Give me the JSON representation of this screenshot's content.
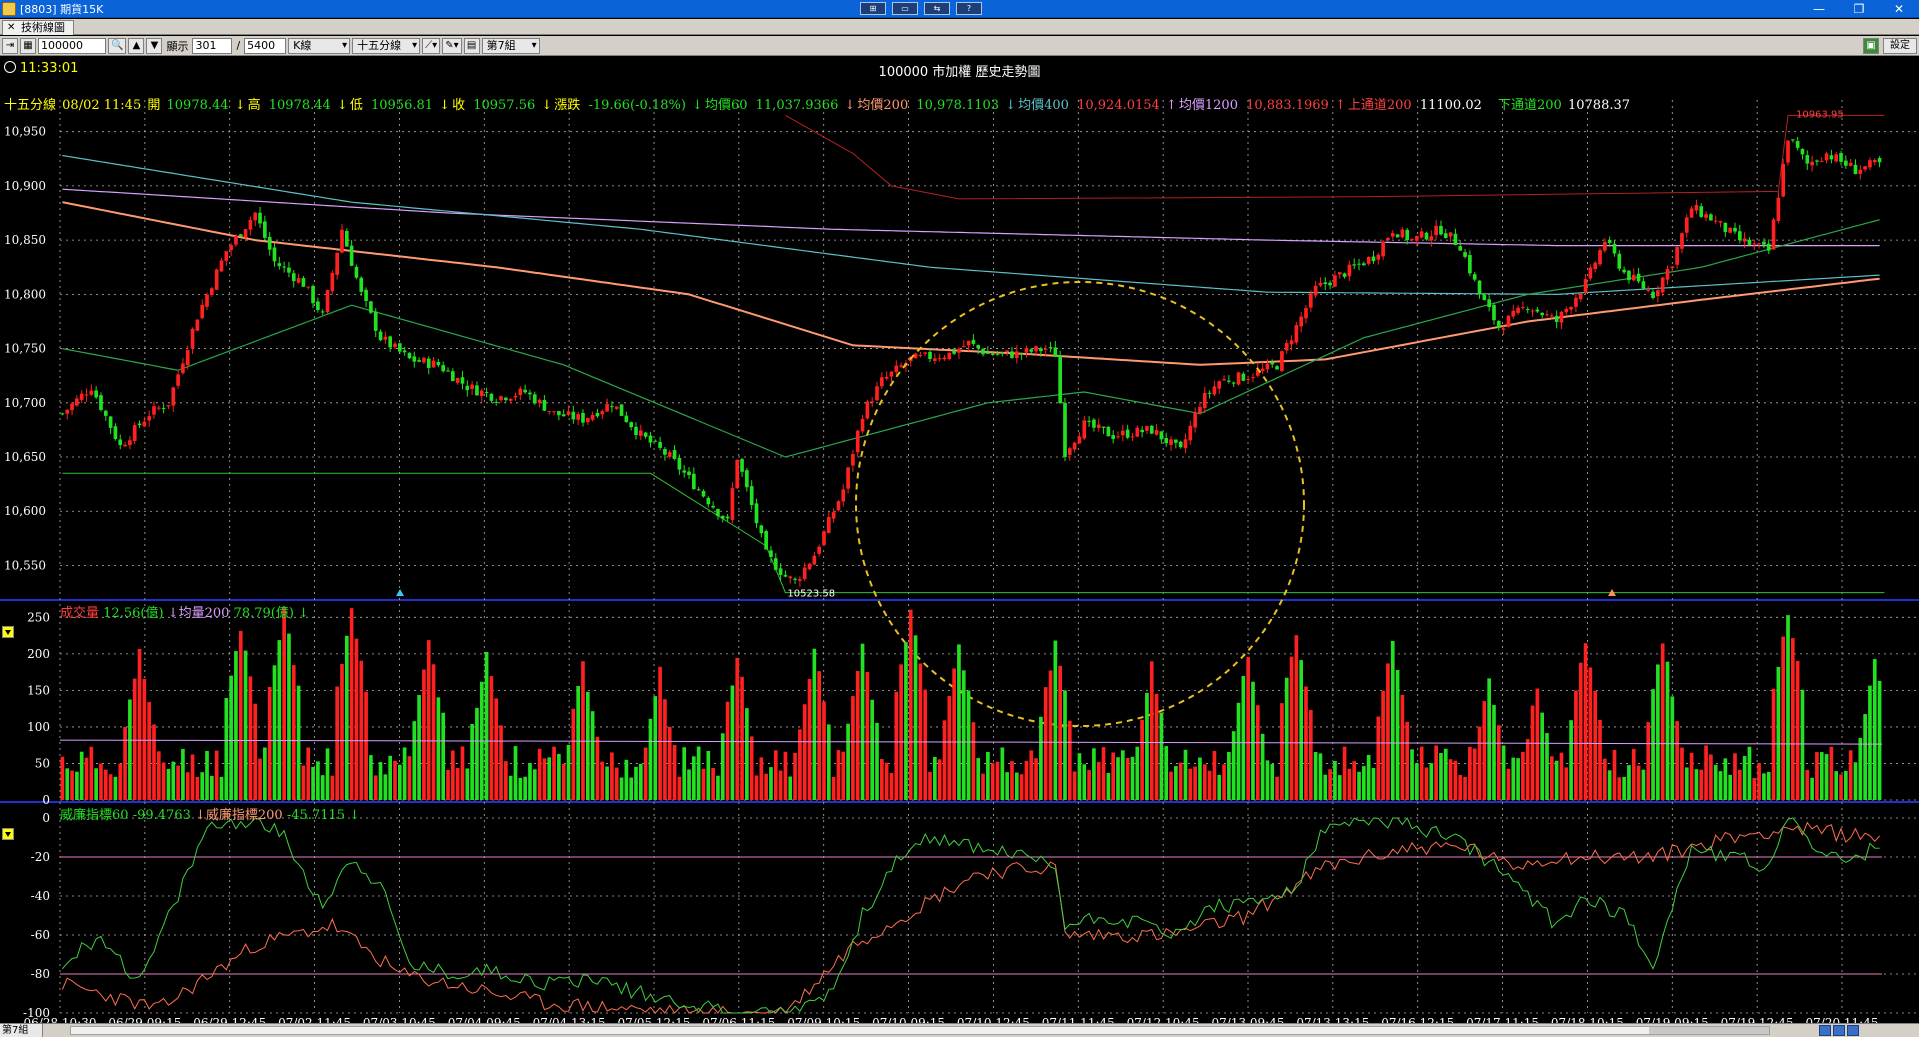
{
  "window": {
    "title": "[8803] 期貨15K",
    "center_buttons": [
      "⊞",
      "▭",
      "⇆",
      "?"
    ],
    "controls": [
      "—",
      "❐",
      "✕"
    ]
  },
  "tab": {
    "label": "技術線圖"
  },
  "toolbar": {
    "symbol": "100000",
    "display_label": "顯示",
    "display_value": "301",
    "slash": "/",
    "total_value": "5400",
    "chart_type": "K線",
    "period": "十五分線",
    "group": "第7組",
    "settings": "設定"
  },
  "header": {
    "clock": "11:33:01",
    "chart_title": "100000 市加權  歷史走勢圖"
  },
  "info_line": {
    "period": "十五分線",
    "datetime": "08/02 11:45",
    "open_label": "開",
    "open": "10978.44",
    "high_label": "高",
    "high": "10978.44",
    "low_label": "低",
    "low": "10956.81",
    "close_label": "收",
    "close": "10957.56",
    "change_label": "漲跌",
    "change": "-19.66(-0.18%)",
    "ma60_label": "均價60",
    "ma60": "11,037.9366",
    "ma200_label": "均價200",
    "ma200": "10,978.1103",
    "ma400_label": "均價400",
    "ma400": "10,924.0154",
    "ma1200_label": "均價1200",
    "ma1200": "10,883.1969",
    "upper_label": "上通道200",
    "upper": "11100.02",
    "lower_label": "下通道200",
    "lower": "10788.37"
  },
  "volume_header": {
    "label": "成交量",
    "value": "12.56(億)",
    "avg_label": "均量200",
    "avg_value": "78.79(億)"
  },
  "williams_header": {
    "label60": "威廉指標60",
    "value60": "-99.4763",
    "label200": "威廉指標200",
    "value200": "-45.7115"
  },
  "bottom": {
    "group": "第7組"
  },
  "colors": {
    "up": "#ff2020",
    "down": "#22e022",
    "grid": "#b0b0b0",
    "ma60": "#2aa84a",
    "ma200": "#ff9a70",
    "ma400": "#5cc0c8",
    "ma1200": "#d9a0ff",
    "upper": "#b82020",
    "lower": "#30c030",
    "circle": "#e8c020",
    "yellow": "#ffff00",
    "white": "#ffffff"
  },
  "chart_data": [
    {
      "type": "candlestick",
      "title": "100000 市加權  歷史走勢圖",
      "ylim": [
        10520,
        10970
      ],
      "y_ticks": [
        10550,
        10600,
        10650,
        10700,
        10750,
        10800,
        10850,
        10900,
        10950
      ],
      "y_tick_labels": [
        "10,550",
        "10,600",
        "10,650",
        "10,700",
        "10,750",
        "10,800",
        "10,850",
        "10,900",
        "10,950"
      ],
      "x_tick_labels": [
        "06/28 10:30",
        "06/29 09:15",
        "06/29 12:45",
        "07/02 11:45",
        "07/03 10:45",
        "07/04 09:45",
        "07/04 13:15",
        "07/05 12:15",
        "07/06 11:15",
        "07/09 10:15",
        "07/10 09:15",
        "07/10 12:45",
        "07/11 11:45",
        "07/12 10:45",
        "07/13 09:45",
        "07/13 13:15",
        "07/16 12:15",
        "07/17 11:15",
        "07/18 10:15",
        "07/19 09:15",
        "07/19 12:45",
        "07/20 11:45"
      ],
      "close_anchors": [
        [
          0,
          10690
        ],
        [
          6,
          10715
        ],
        [
          12,
          10660
        ],
        [
          18,
          10690
        ],
        [
          22,
          10700
        ],
        [
          28,
          10780
        ],
        [
          34,
          10840
        ],
        [
          40,
          10875
        ],
        [
          44,
          10830
        ],
        [
          50,
          10810
        ],
        [
          54,
          10780
        ],
        [
          58,
          10860
        ],
        [
          62,
          10800
        ],
        [
          66,
          10760
        ],
        [
          72,
          10740
        ],
        [
          78,
          10735
        ],
        [
          84,
          10715
        ],
        [
          90,
          10705
        ],
        [
          96,
          10710
        ],
        [
          102,
          10690
        ],
        [
          108,
          10685
        ],
        [
          114,
          10700
        ],
        [
          120,
          10670
        ],
        [
          126,
          10650
        ],
        [
          132,
          10620
        ],
        [
          138,
          10590
        ],
        [
          140,
          10650
        ],
        [
          146,
          10560
        ],
        [
          150,
          10540
        ],
        [
          152,
          10535
        ],
        [
          156,
          10560
        ],
        [
          160,
          10600
        ],
        [
          162,
          10620
        ],
        [
          166,
          10690
        ],
        [
          170,
          10720
        ],
        [
          176,
          10740
        ],
        [
          184,
          10745
        ],
        [
          188,
          10755
        ],
        [
          192,
          10745
        ],
        [
          198,
          10745
        ],
        [
          204,
          10750
        ],
        [
          206,
          10745
        ],
        [
          208,
          10655
        ],
        [
          212,
          10680
        ],
        [
          218,
          10670
        ],
        [
          226,
          10675
        ],
        [
          232,
          10655
        ],
        [
          236,
          10700
        ],
        [
          240,
          10720
        ],
        [
          246,
          10725
        ],
        [
          252,
          10735
        ],
        [
          256,
          10770
        ],
        [
          260,
          10805
        ],
        [
          266,
          10820
        ],
        [
          272,
          10835
        ],
        [
          276,
          10860
        ],
        [
          280,
          10850
        ],
        [
          286,
          10860
        ],
        [
          290,
          10845
        ],
        [
          294,
          10800
        ],
        [
          298,
          10770
        ],
        [
          304,
          10790
        ],
        [
          310,
          10775
        ],
        [
          316,
          10810
        ],
        [
          320,
          10850
        ],
        [
          324,
          10820
        ],
        [
          330,
          10800
        ],
        [
          334,
          10830
        ],
        [
          338,
          10880
        ],
        [
          342,
          10870
        ],
        [
          348,
          10850
        ],
        [
          354,
          10840
        ],
        [
          358,
          10945
        ],
        [
          362,
          10920
        ],
        [
          366,
          10930
        ],
        [
          372,
          10915
        ],
        [
          376,
          10920
        ]
      ],
      "ma60_anchors": [
        [
          0,
          10750
        ],
        [
          24,
          10730
        ],
        [
          60,
          10790
        ],
        [
          104,
          10735
        ],
        [
          150,
          10650
        ],
        [
          192,
          10700
        ],
        [
          212,
          10710
        ],
        [
          236,
          10690
        ],
        [
          270,
          10760
        ],
        [
          304,
          10800
        ],
        [
          340,
          10825
        ],
        [
          378,
          10870
        ]
      ],
      "ma200_anchors": [
        [
          0,
          10885
        ],
        [
          40,
          10850
        ],
        [
          90,
          10825
        ],
        [
          130,
          10800
        ],
        [
          164,
          10753
        ],
        [
          200,
          10745
        ],
        [
          236,
          10735
        ],
        [
          262,
          10740
        ],
        [
          304,
          10775
        ],
        [
          340,
          10795
        ],
        [
          378,
          10815
        ]
      ],
      "ma400_anchors": [
        [
          0,
          10928
        ],
        [
          60,
          10885
        ],
        [
          120,
          10860
        ],
        [
          180,
          10825
        ],
        [
          250,
          10802
        ],
        [
          310,
          10800
        ],
        [
          378,
          10818
        ]
      ],
      "ma1200_anchors": [
        [
          0,
          10897
        ],
        [
          80,
          10875
        ],
        [
          160,
          10860
        ],
        [
          250,
          10850
        ],
        [
          310,
          10845
        ],
        [
          378,
          10845
        ]
      ],
      "upper_channel": [
        [
          150,
          10965
        ],
        [
          164,
          10930
        ],
        [
          172,
          10900
        ],
        [
          186,
          10888
        ],
        [
          270,
          10890
        ],
        [
          356,
          10895
        ],
        [
          358,
          10965
        ],
        [
          378,
          10965
        ]
      ],
      "lower_channel": [
        [
          0,
          10635
        ],
        [
          122,
          10635
        ],
        [
          146,
          10568
        ],
        [
          150,
          10525
        ],
        [
          378,
          10525
        ]
      ],
      "annotations": [
        {
          "text": "10523.58"
        },
        {
          "text": "10963.95"
        }
      ],
      "n_bars": 378
    },
    {
      "type": "bar",
      "title": "成交量",
      "ylim": [
        0,
        260
      ],
      "y_ticks": [
        0,
        50,
        100,
        150,
        200,
        250
      ],
      "avg_line": 82,
      "peaks": [
        [
          16,
          195
        ],
        [
          37,
          230
        ],
        [
          46,
          250
        ],
        [
          60,
          250
        ],
        [
          76,
          210
        ],
        [
          88,
          195
        ],
        [
          108,
          180
        ],
        [
          124,
          170
        ],
        [
          140,
          190
        ],
        [
          156,
          200
        ],
        [
          166,
          200
        ],
        [
          176,
          250
        ],
        [
          186,
          205
        ],
        [
          206,
          210
        ],
        [
          226,
          175
        ],
        [
          246,
          190
        ],
        [
          256,
          225
        ],
        [
          276,
          210
        ],
        [
          296,
          165
        ],
        [
          306,
          150
        ],
        [
          316,
          210
        ],
        [
          332,
          210
        ],
        [
          358,
          250
        ],
        [
          376,
          185
        ]
      ]
    },
    {
      "type": "line",
      "title": "威廉指標",
      "ylim": [
        -100,
        0
      ],
      "y_ticks": [
        0,
        -20,
        -40,
        -60,
        -80,
        -100
      ],
      "ref_lines": [
        -20,
        -80
      ],
      "wr60_anchors": [
        [
          0,
          -75
        ],
        [
          8,
          -60
        ],
        [
          16,
          -85
        ],
        [
          24,
          -40
        ],
        [
          30,
          -5
        ],
        [
          40,
          0
        ],
        [
          46,
          -10
        ],
        [
          54,
          -45
        ],
        [
          60,
          -20
        ],
        [
          66,
          -35
        ],
        [
          72,
          -75
        ],
        [
          80,
          -80
        ],
        [
          90,
          -78
        ],
        [
          100,
          -85
        ],
        [
          110,
          -82
        ],
        [
          120,
          -90
        ],
        [
          130,
          -95
        ],
        [
          140,
          -100
        ],
        [
          150,
          -100
        ],
        [
          160,
          -88
        ],
        [
          166,
          -50
        ],
        [
          172,
          -25
        ],
        [
          180,
          -10
        ],
        [
          190,
          -15
        ],
        [
          200,
          -20
        ],
        [
          206,
          -25
        ],
        [
          208,
          -55
        ],
        [
          216,
          -50
        ],
        [
          226,
          -55
        ],
        [
          232,
          -60
        ],
        [
          238,
          -45
        ],
        [
          246,
          -45
        ],
        [
          256,
          -35
        ],
        [
          262,
          -5
        ],
        [
          272,
          0
        ],
        [
          282,
          -5
        ],
        [
          292,
          -15
        ],
        [
          300,
          -30
        ],
        [
          310,
          -55
        ],
        [
          316,
          -40
        ],
        [
          324,
          -50
        ],
        [
          330,
          -75
        ],
        [
          338,
          -15
        ],
        [
          346,
          -20
        ],
        [
          354,
          -25
        ],
        [
          358,
          0
        ],
        [
          364,
          -15
        ],
        [
          370,
          -25
        ],
        [
          376,
          -15
        ]
      ],
      "wr200_anchors": [
        [
          0,
          -85
        ],
        [
          20,
          -98
        ],
        [
          40,
          -65
        ],
        [
          56,
          -55
        ],
        [
          70,
          -80
        ],
        [
          100,
          -95
        ],
        [
          130,
          -100
        ],
        [
          150,
          -100
        ],
        [
          164,
          -65
        ],
        [
          190,
          -28
        ],
        [
          206,
          -25
        ],
        [
          208,
          -60
        ],
        [
          230,
          -60
        ],
        [
          246,
          -50
        ],
        [
          262,
          -25
        ],
        [
          280,
          -15
        ],
        [
          292,
          -15
        ],
        [
          300,
          -25
        ],
        [
          310,
          -20
        ],
        [
          330,
          -20
        ],
        [
          346,
          -10
        ],
        [
          358,
          -5
        ],
        [
          376,
          -10
        ]
      ]
    }
  ]
}
